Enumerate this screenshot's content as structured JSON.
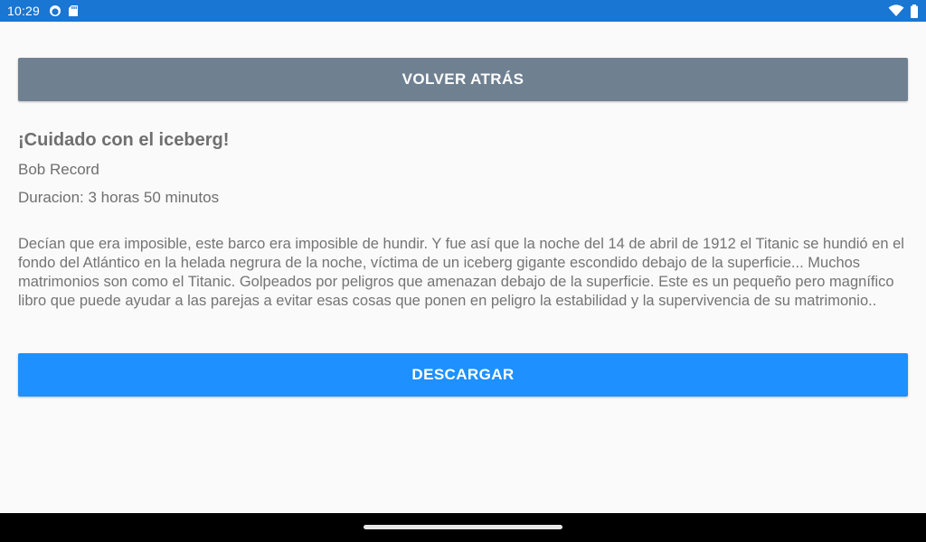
{
  "status_bar": {
    "time": "10:29",
    "icons_left": [
      "sync-icon",
      "sd-card-icon"
    ],
    "icons_right": [
      "wifi-icon",
      "battery-icon"
    ]
  },
  "colors": {
    "status_bar": "#1976d2",
    "back_button": "#6f8091",
    "download_button": "#1e90ff",
    "background": "#fafafa"
  },
  "buttons": {
    "back_label": "VOLVER ATRÁS",
    "download_label": "DESCARGAR"
  },
  "book": {
    "title": "¡Cuidado con el iceberg!",
    "author": "Bob Record",
    "duration": "Duracion: 3 horas 50 minutos",
    "description": "Decían que era imposible, este barco era imposible de hundir. Y fue así que la noche del 14 de abril de 1912 el Titanic se hundió en el fondo del Atlántico en la helada negrura de la noche, víctima de un iceberg gigante escondido debajo de la superficie... Muchos matrimonios son como el Titanic. Golpeados por peligros que amenazan debajo de la superficie. Este es un pequeño pero magnífico libro que puede ayudar a las parejas a evitar esas cosas que ponen en peligro la estabilidad y la supervivencia de su matrimonio.."
  }
}
